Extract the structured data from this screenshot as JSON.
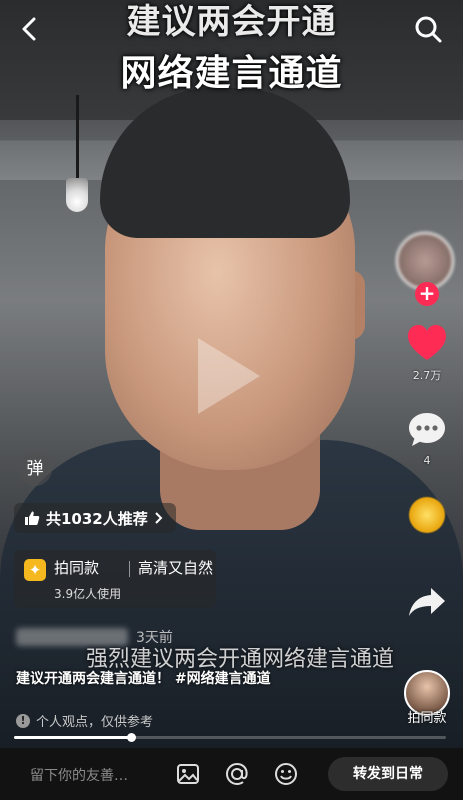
{
  "video": {
    "title_line1": "建议两会开通",
    "title_line2": "网络建言通道",
    "subtitle": "强烈建议两会开通网络建言通道"
  },
  "rail": {
    "likes": "2.7万",
    "comments": "4",
    "same_style_label": "拍同款"
  },
  "info": {
    "danmu_label": "弹",
    "recommend": "共1032人推荐",
    "effect_name": "拍同款",
    "effect_tag": "高清又自然",
    "effect_users": "3.9亿人使用",
    "time": "3天前",
    "caption": "建议开通两会建言通道！ #网络建言通道",
    "notice": "个人观点，仅供参考"
  },
  "progress": {
    "fraction": 0.27
  },
  "bottom": {
    "comment_placeholder": "留下你的友善…",
    "forward": "转发到日常"
  },
  "colors": {
    "accent": "#fe2c55",
    "effect_icon": "#f5b81e"
  },
  "icons": [
    "back-icon",
    "search-icon",
    "heart-icon",
    "comment-icon",
    "share-icon",
    "image-icon",
    "at-icon",
    "emoji-icon",
    "chevron-right-icon",
    "thumbs-up-icon",
    "info-icon",
    "sparkle-icon"
  ]
}
